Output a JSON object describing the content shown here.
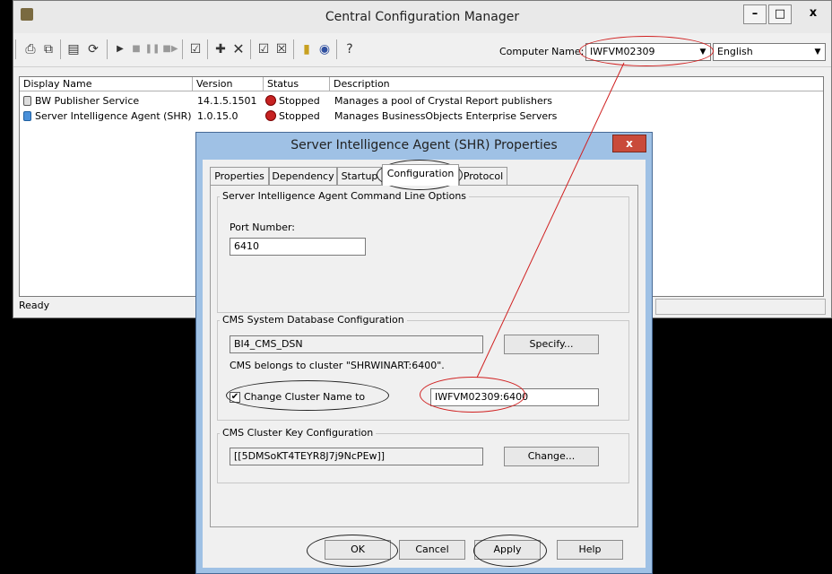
{
  "app": {
    "title": "Central Configuration Manager",
    "window_buttons": {
      "minimize": "–",
      "maximize": "□",
      "close": "x"
    }
  },
  "toolbar": {
    "computer_name_label": "Computer Name:",
    "computer_name_value": "IWFVM02309",
    "language_value": "English",
    "icons": [
      "print-icon",
      "copy-icon",
      "properties-icon",
      "refresh-icon",
      "start-icon",
      "stop-icon",
      "pause-icon",
      "resume-icon",
      "disable-icon",
      "add-server-icon",
      "delete-icon",
      "enable-icon",
      "server-settings-icon",
      "database-icon",
      "metrics-icon",
      "help-icon"
    ]
  },
  "list": {
    "columns": [
      "Display Name",
      "Version",
      "Status",
      "Description"
    ],
    "rows": [
      {
        "name": "BW Publisher Service",
        "version": "14.1.5.1501",
        "status": "Stopped",
        "description": "Manages a pool of Crystal Report publishers"
      },
      {
        "name": "Server Intelligence Agent (SHR)",
        "version": "1.0.15.0",
        "status": "Stopped",
        "description": "Manages BusinessObjects Enterprise Servers"
      }
    ]
  },
  "statusbar": {
    "text": "Ready"
  },
  "dialog": {
    "title": "Server Intelligence Agent (SHR) Properties",
    "close": "x",
    "tabs": [
      "Properties",
      "Dependency",
      "Startup",
      "Configuration",
      "Protocol"
    ],
    "active_tab": "Configuration",
    "group1": {
      "title": "Server Intelligence Agent Command Line Options",
      "port_label": "Port Number:",
      "port_value": "6410"
    },
    "group2": {
      "title": "CMS System Database Configuration",
      "dsn_value": "BI4_CMS_DSN",
      "specify_button": "Specify...",
      "cluster_text": "CMS belongs to cluster \"SHRWINART:6400\".",
      "change_cluster_label": "Change Cluster Name to",
      "change_cluster_checked": true,
      "cluster_name_value": "IWFVM02309:6400"
    },
    "group3": {
      "title": "CMS Cluster Key Configuration",
      "key_value": "[[5DMSoKT4TEYR8J7j9NcPEw]]",
      "change_button": "Change..."
    },
    "buttons": {
      "ok": "OK",
      "cancel": "Cancel",
      "apply": "Apply",
      "help": "Help"
    }
  },
  "colors": {
    "dialog_frame": "#9fc1e5",
    "annotation_red": "#d02020",
    "stopped_icon": "#c62222"
  }
}
